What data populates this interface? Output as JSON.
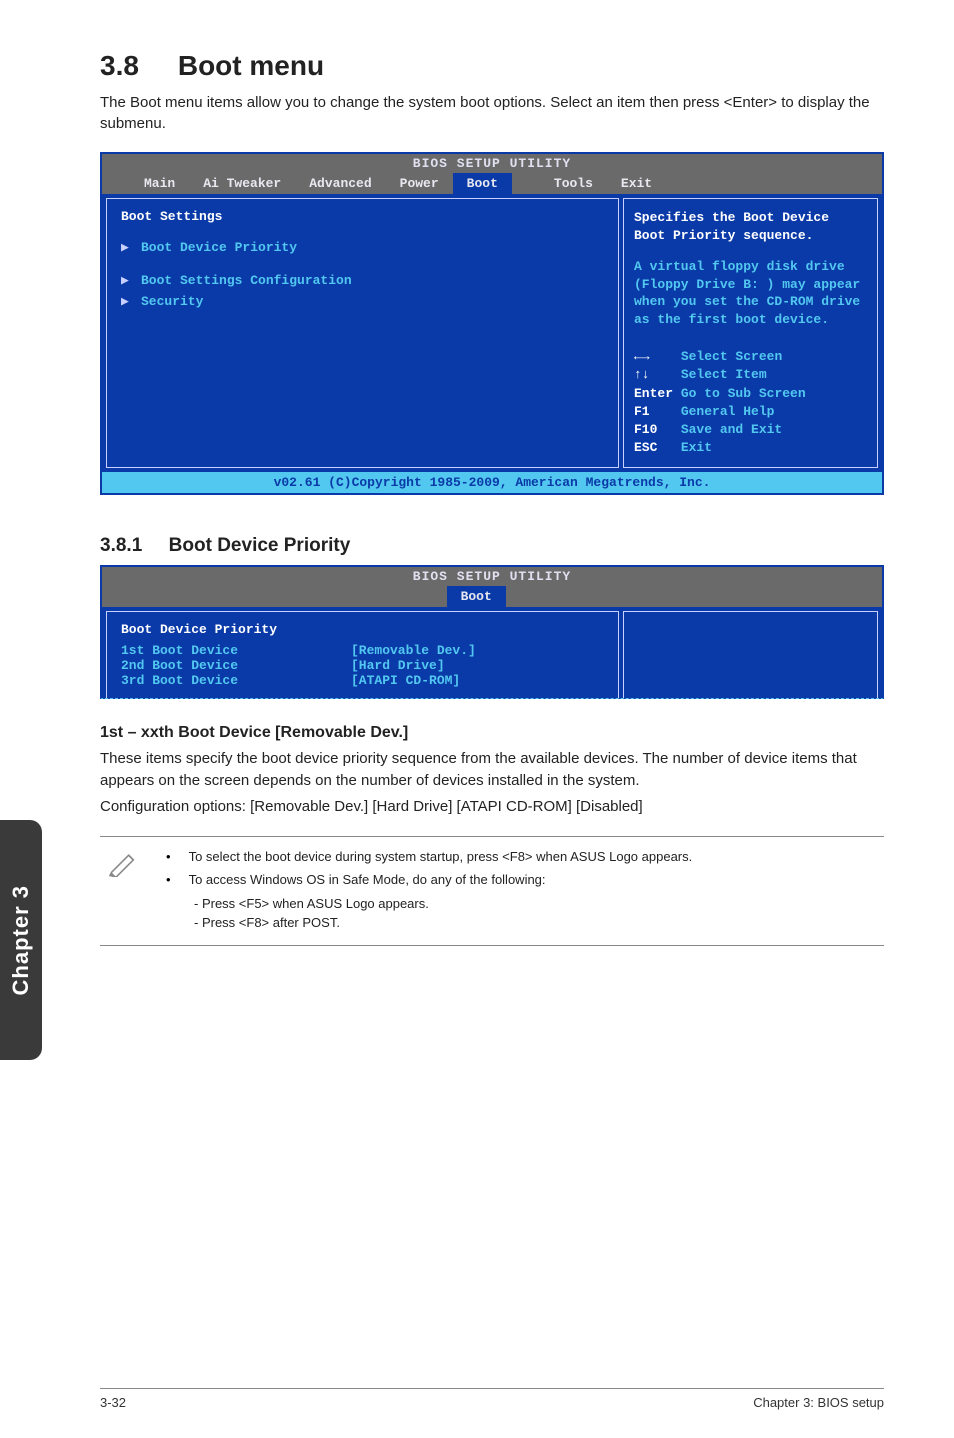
{
  "section": {
    "number": "3.8",
    "title": "Boot menu"
  },
  "intro": "The Boot menu items allow you to change the system boot options. Select an item then press <Enter> to display the submenu.",
  "bios1": {
    "bsu": "BIOS SETUP UTILITY",
    "tabs": [
      "Main",
      "Ai Tweaker",
      "Advanced",
      "Power",
      "Boot",
      "Tools",
      "Exit"
    ],
    "active_tab": "Boot",
    "heading": "Boot Settings",
    "items": [
      "Boot Device Priority",
      "Boot Settings Configuration",
      "Security"
    ],
    "help_desc1": "Specifies the Boot Device",
    "help_desc2": "Boot Priority sequence.",
    "help_virt": "A virtual floppy disk drive (Floppy Drive B: ) may appear when you set the CD-ROM drive as the first boot device.",
    "keys": {
      "l1": {
        "hint": "←→",
        "label": "Select Screen"
      },
      "l2": {
        "hint": "↑↓",
        "label": "Select Item"
      },
      "l3": {
        "hint": "Enter",
        "label": "Go to Sub Screen"
      },
      "l4": {
        "hint": "F1",
        "label": "General Help"
      },
      "l5": {
        "hint": "F10",
        "label": "Save and Exit"
      },
      "l6": {
        "hint": "ESC",
        "label": "Exit"
      }
    },
    "footer": "v02.61 (C)Copyright 1985-2009, American Megatrends, Inc."
  },
  "sub": {
    "number": "3.8.1",
    "title": "Boot Device Priority"
  },
  "bios2": {
    "bsu": "BIOS SETUP UTILITY",
    "active_tab": "Boot",
    "heading": "Boot Device Priority",
    "rows": [
      {
        "name": "1st Boot Device",
        "val": "[Removable Dev.]"
      },
      {
        "name": "2nd Boot Device",
        "val": "[Hard Drive]"
      },
      {
        "name": "3rd Boot Device",
        "val": "[ATAPI CD-ROM]"
      }
    ]
  },
  "para": {
    "h": "1st – xxth Boot Device [Removable Dev.]",
    "p1": "These items specify the boot device priority sequence from the available devices. The number of device items that appears on the screen depends on the number of devices installed in the system.",
    "p2": "Configuration options: [Removable Dev.] [Hard Drive] [ATAPI CD-ROM] [Disabled]"
  },
  "note": {
    "b1": "To select the boot device during system startup, press <F8> when ASUS Logo appears.",
    "b2": "To access Windows OS in Safe Mode, do any of the following:",
    "b2a": "- Press <F5> when ASUS Logo appears.",
    "b2b": "- Press <F8> after POST."
  },
  "sidetab": "Chapter 3",
  "footer": {
    "left": "3-32",
    "right": "Chapter 3: BIOS setup"
  }
}
